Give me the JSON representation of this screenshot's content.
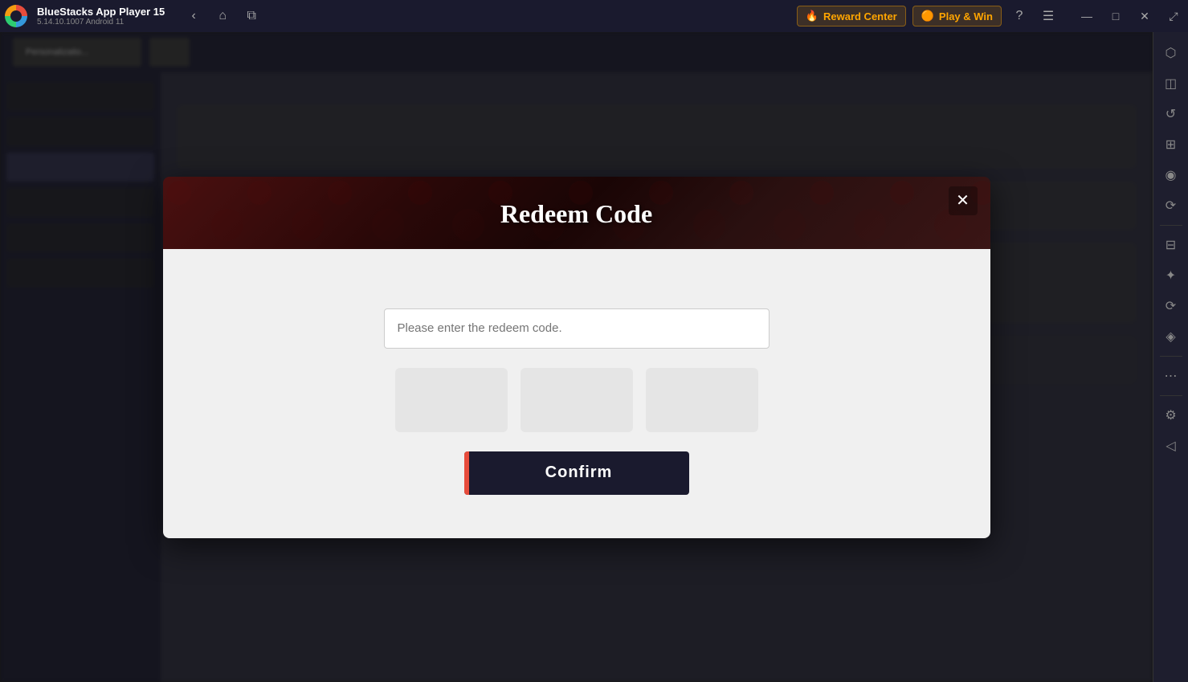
{
  "app": {
    "name": "BlueStacks App Player 15",
    "version": "5.14.10.1007  Android 11"
  },
  "titlebar": {
    "reward_center_label": "Reward Center",
    "play_win_label": "Play & Win",
    "nav": {
      "back": "‹",
      "home": "⌂",
      "tabs": "⧉"
    },
    "window_controls": {
      "minimize": "—",
      "maximize": "□",
      "close": "✕",
      "expand": "⤢"
    }
  },
  "right_sidebar": {
    "icons": [
      "⬡",
      "◫",
      "↺",
      "⊞",
      "◉",
      "⟳",
      "⊟",
      "✦",
      "⟳",
      "◈",
      "⋯",
      "⚙",
      "◁"
    ]
  },
  "dialog": {
    "title": "Redeem Code",
    "close_label": "✕",
    "input_placeholder": "Please enter the redeem code.",
    "confirm_label": "Confirm"
  }
}
